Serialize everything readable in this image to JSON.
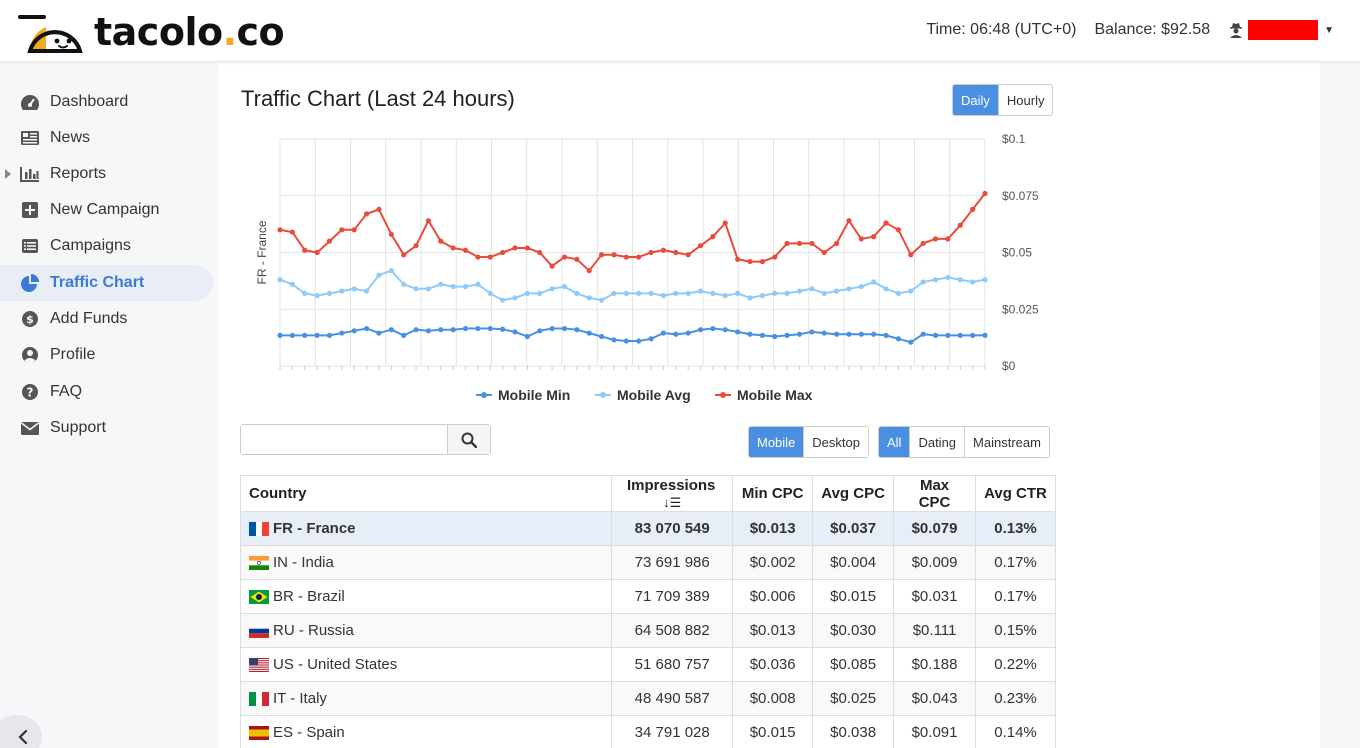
{
  "header": {
    "brand": {
      "main": "tacolo",
      "dot": ".",
      "tld": "co"
    },
    "time": "Time: 06:48 (UTC+0)",
    "balance": "Balance: $92.58"
  },
  "sidebar": {
    "items": [
      {
        "label": "Dashboard",
        "icon": "dashboard-icon"
      },
      {
        "label": "News",
        "icon": "news-icon"
      },
      {
        "label": "Reports",
        "icon": "bar-chart-icon"
      },
      {
        "label": "New Campaign",
        "icon": "plus-square-icon"
      },
      {
        "label": "Campaigns",
        "icon": "list-icon"
      },
      {
        "label": "Traffic Chart",
        "icon": "pie-chart-icon"
      },
      {
        "label": "Add Funds",
        "icon": "dollar-circle-icon"
      },
      {
        "label": "Profile",
        "icon": "user-circle-icon"
      },
      {
        "label": "FAQ",
        "icon": "question-circle-icon"
      },
      {
        "label": "Support",
        "icon": "envelope-icon"
      }
    ],
    "active": "Traffic Chart"
  },
  "main": {
    "title": "Traffic Chart (Last 24 hours)",
    "period_toggle": {
      "daily": "Daily",
      "hourly": "Hourly",
      "selected": "Daily"
    },
    "device_toggle": {
      "mobile": "Mobile",
      "desktop": "Desktop",
      "selected": "Mobile"
    },
    "category_toggle": {
      "all": "All",
      "dating": "Dating",
      "mainstream": "Mainstream",
      "selected": "All"
    },
    "search": {
      "placeholder": "",
      "value": ""
    }
  },
  "chart_data": {
    "type": "line",
    "ylabel": "FR - France",
    "ylim": [
      0,
      0.1
    ],
    "yticks": [
      "$0",
      "$0.025",
      "$0.05",
      "$0.075",
      "$0.1"
    ],
    "ytick_values": [
      0,
      0.025,
      0.05,
      0.075,
      0.1
    ],
    "grid": true,
    "legend_position": "bottom",
    "series": [
      {
        "name": "Mobile Min",
        "color": "#4a90e2",
        "values": [
          0.0135,
          0.0135,
          0.0135,
          0.0135,
          0.0135,
          0.0145,
          0.0155,
          0.0165,
          0.0145,
          0.016,
          0.0135,
          0.016,
          0.0155,
          0.016,
          0.016,
          0.0165,
          0.0165,
          0.0165,
          0.0162,
          0.015,
          0.013,
          0.0155,
          0.0165,
          0.0165,
          0.016,
          0.0145,
          0.013,
          0.0115,
          0.011,
          0.011,
          0.012,
          0.0145,
          0.014,
          0.0145,
          0.016,
          0.0165,
          0.016,
          0.015,
          0.014,
          0.0135,
          0.013,
          0.0135,
          0.014,
          0.015,
          0.0145,
          0.014,
          0.014,
          0.014,
          0.014,
          0.0135,
          0.012,
          0.0105,
          0.014,
          0.0135,
          0.0135,
          0.0135,
          0.0135,
          0.0135
        ]
      },
      {
        "name": "Mobile Avg",
        "color": "#90caf9",
        "values": [
          0.038,
          0.036,
          0.032,
          0.031,
          0.032,
          0.033,
          0.034,
          0.033,
          0.04,
          0.042,
          0.036,
          0.034,
          0.034,
          0.036,
          0.035,
          0.035,
          0.036,
          0.032,
          0.029,
          0.03,
          0.032,
          0.032,
          0.034,
          0.035,
          0.032,
          0.03,
          0.029,
          0.032,
          0.032,
          0.032,
          0.032,
          0.031,
          0.032,
          0.032,
          0.033,
          0.032,
          0.031,
          0.032,
          0.03,
          0.031,
          0.032,
          0.032,
          0.033,
          0.034,
          0.032,
          0.033,
          0.034,
          0.035,
          0.037,
          0.034,
          0.032,
          0.033,
          0.037,
          0.038,
          0.039,
          0.038,
          0.037,
          0.038
        ]
      },
      {
        "name": "Mobile Max",
        "color": "#e74c3c",
        "values": [
          0.06,
          0.059,
          0.051,
          0.05,
          0.055,
          0.06,
          0.06,
          0.067,
          0.069,
          0.058,
          0.049,
          0.053,
          0.064,
          0.055,
          0.052,
          0.051,
          0.048,
          0.048,
          0.05,
          0.052,
          0.052,
          0.05,
          0.044,
          0.048,
          0.047,
          0.042,
          0.049,
          0.049,
          0.048,
          0.048,
          0.05,
          0.051,
          0.05,
          0.049,
          0.053,
          0.057,
          0.063,
          0.047,
          0.046,
          0.046,
          0.048,
          0.054,
          0.054,
          0.054,
          0.05,
          0.054,
          0.064,
          0.056,
          0.057,
          0.063,
          0.06,
          0.049,
          0.054,
          0.056,
          0.056,
          0.062,
          0.069,
          0.076
        ]
      }
    ]
  },
  "table": {
    "columns": [
      "Country",
      "Impressions",
      "Min CPC",
      "Avg CPC",
      "Max CPC",
      "Avg CTR"
    ],
    "rows": [
      {
        "code": "fr",
        "country": "FR - France",
        "impressions": "83 070 549",
        "min": "$0.013",
        "avg": "$0.037",
        "max": "$0.079",
        "ctr": "0.13%"
      },
      {
        "code": "in",
        "country": "IN - India",
        "impressions": "73 691 986",
        "min": "$0.002",
        "avg": "$0.004",
        "max": "$0.009",
        "ctr": "0.17%"
      },
      {
        "code": "br",
        "country": "BR - Brazil",
        "impressions": "71 709 389",
        "min": "$0.006",
        "avg": "$0.015",
        "max": "$0.031",
        "ctr": "0.17%"
      },
      {
        "code": "ru",
        "country": "RU - Russia",
        "impressions": "64 508 882",
        "min": "$0.013",
        "avg": "$0.030",
        "max": "$0.111",
        "ctr": "0.15%"
      },
      {
        "code": "us",
        "country": "US - United States",
        "impressions": "51 680 757",
        "min": "$0.036",
        "avg": "$0.085",
        "max": "$0.188",
        "ctr": "0.22%"
      },
      {
        "code": "it",
        "country": "IT - Italy",
        "impressions": "48 490 587",
        "min": "$0.008",
        "avg": "$0.025",
        "max": "$0.043",
        "ctr": "0.23%"
      },
      {
        "code": "es",
        "country": "ES - Spain",
        "impressions": "34 791 028",
        "min": "$0.015",
        "avg": "$0.038",
        "max": "$0.091",
        "ctr": "0.14%"
      }
    ]
  }
}
